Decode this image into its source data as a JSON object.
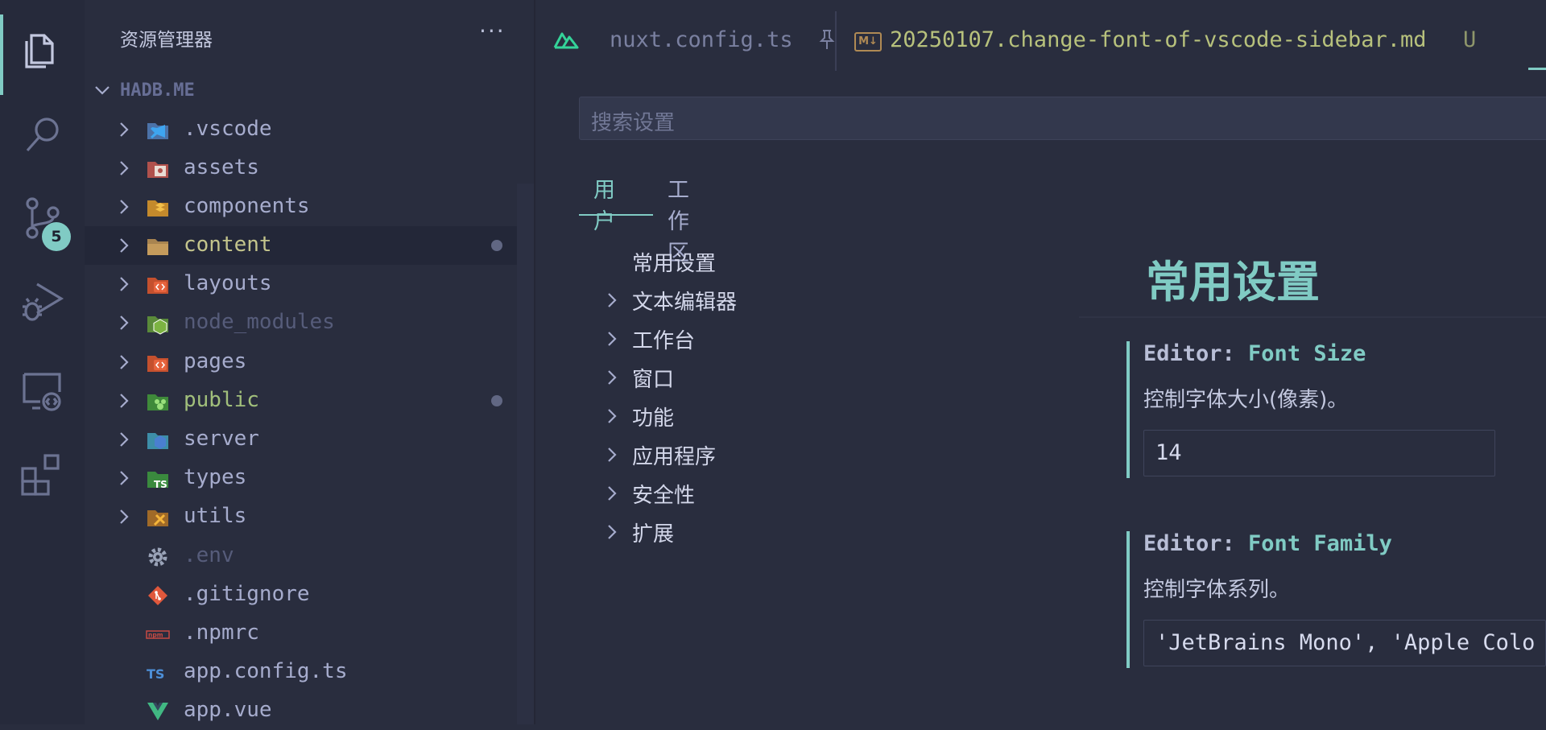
{
  "activity_bar": {
    "items": [
      {
        "name": "explorer",
        "icon": "files-icon",
        "active": true
      },
      {
        "name": "search",
        "icon": "search-icon"
      },
      {
        "name": "source-control",
        "icon": "source-control-icon",
        "badge": "5"
      },
      {
        "name": "run-debug",
        "icon": "run-debug-icon"
      },
      {
        "name": "remote-explorer",
        "icon": "remote-explorer-icon"
      },
      {
        "name": "extensions",
        "icon": "extensions-icon"
      }
    ]
  },
  "sidebar": {
    "title": "资源管理器",
    "more_label": "···",
    "root": "HADB.ME",
    "items": [
      {
        "label": ".vscode",
        "type": "folder",
        "icon": "vscode-folder-icon"
      },
      {
        "label": "assets",
        "type": "folder",
        "icon": "assets-folder-icon"
      },
      {
        "label": "components",
        "type": "folder",
        "icon": "components-folder-icon"
      },
      {
        "label": "content",
        "type": "folder",
        "icon": "folder-icon",
        "selected": true,
        "modified_dot": true
      },
      {
        "label": "layouts",
        "type": "folder",
        "icon": "layouts-folder-icon"
      },
      {
        "label": "node_modules",
        "type": "folder",
        "icon": "node-folder-icon",
        "dimmed": true
      },
      {
        "label": "pages",
        "type": "folder",
        "icon": "pages-folder-icon"
      },
      {
        "label": "public",
        "type": "folder",
        "icon": "public-folder-icon",
        "modified": true,
        "modified_dot": true
      },
      {
        "label": "server",
        "type": "folder",
        "icon": "server-folder-icon"
      },
      {
        "label": "types",
        "type": "folder",
        "icon": "types-folder-icon"
      },
      {
        "label": "utils",
        "type": "folder",
        "icon": "utils-folder-icon"
      },
      {
        "label": ".env",
        "type": "file",
        "icon": "gear-icon",
        "dimmed": true
      },
      {
        "label": ".gitignore",
        "type": "file",
        "icon": "git-icon"
      },
      {
        "label": ".npmrc",
        "type": "file",
        "icon": "npm-icon"
      },
      {
        "label": "app.config.ts",
        "type": "file",
        "icon": "typescript-icon",
        "icon_text": "TS"
      },
      {
        "label": "app.vue",
        "type": "file",
        "icon": "vue-icon"
      }
    ]
  },
  "tabs": [
    {
      "label": "nuxt.config.ts",
      "icon": "nuxt-icon",
      "pinned": true
    },
    {
      "label": "20250107.change-font-of-vscode-sidebar.md",
      "icon": "markdown-icon",
      "icon_text": "M↓",
      "status": "U"
    }
  ],
  "settings": {
    "search_placeholder": "搜索设置",
    "scope_tabs": [
      "用户",
      "工作区"
    ],
    "active_scope": "用户",
    "toc": [
      {
        "label": "常用设置",
        "expandable": false
      },
      {
        "label": "文本编辑器",
        "expandable": true
      },
      {
        "label": "工作台",
        "expandable": true
      },
      {
        "label": "窗口",
        "expandable": true
      },
      {
        "label": "功能",
        "expandable": true
      },
      {
        "label": "应用程序",
        "expandable": true
      },
      {
        "label": "安全性",
        "expandable": true
      },
      {
        "label": "扩展",
        "expandable": true
      }
    ],
    "section_title": "常用设置",
    "items": [
      {
        "category": "Editor: ",
        "key": "Font Size",
        "description": "控制字体大小(像素)。",
        "value": "14"
      },
      {
        "category": "Editor: ",
        "key": "Font Family",
        "description": "控制字体系列。",
        "value": "'JetBrains Mono', 'Apple Colo"
      }
    ]
  },
  "colors": {
    "background": "#292d3e",
    "accent": "#80cbc4",
    "modified": "#c3e88d"
  }
}
